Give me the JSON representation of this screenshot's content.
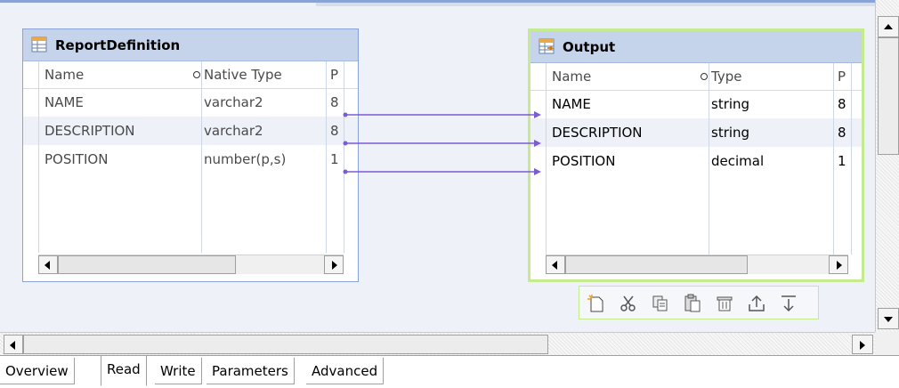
{
  "colors": {
    "canvas_bg": "#eef1f8",
    "title_bg": "#c5d4ea",
    "selected_border": "#c4ec8e",
    "link_line": "#7b5bd6"
  },
  "report_definition": {
    "title": "ReportDefinition",
    "icon": "table-icon",
    "columns": [
      "Name",
      "Native Type",
      "P"
    ],
    "rows": [
      {
        "name": "NAME",
        "type": "varchar2",
        "p": "8"
      },
      {
        "name": "DESCRIPTION",
        "type": "varchar2",
        "p": "8"
      },
      {
        "name": "POSITION",
        "type": "number(p,s)",
        "p": "1"
      }
    ]
  },
  "output": {
    "title": "Output",
    "icon": "output-table-icon",
    "columns": [
      "Name",
      "Type",
      "P"
    ],
    "rows": [
      {
        "name": "NAME",
        "type": "string",
        "p": "8"
      },
      {
        "name": "DESCRIPTION",
        "type": "string",
        "p": "8"
      },
      {
        "name": "POSITION",
        "type": "decimal",
        "p": "1"
      }
    ]
  },
  "toolbar": {
    "buttons": [
      "new-port-icon",
      "cut-icon",
      "copy-icon",
      "paste-icon",
      "delete-icon",
      "move-up-icon",
      "move-down-icon"
    ]
  },
  "tabs": [
    {
      "label": "Overview",
      "active": false
    },
    {
      "label": "Read",
      "active": true
    },
    {
      "label": "Write",
      "active": false
    },
    {
      "label": "Parameters",
      "active": false
    },
    {
      "label": "Advanced",
      "active": false
    }
  ]
}
